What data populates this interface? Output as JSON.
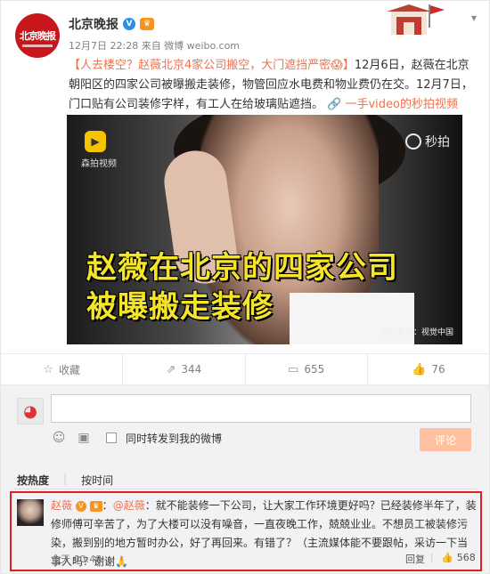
{
  "post": {
    "author": "北京晚报",
    "avatar_text": "北京晚报",
    "badge_v": "V",
    "badge_vip": "♛",
    "meta": "12月7日 22:28 来自 微博 weibo.com",
    "topic": "【人去楼空？赵薇北京4家公司搬空，大门遮挡严密😱】",
    "body": "12月6日，赵薇在北京朝阳区的四家公司被曝搬走装修，物管回应水电费和物业费仍在交。12月7日，门口贴有公司装修字样，有工人在给玻璃贴遮挡。",
    "link": "一手video的秒拍视频",
    "link_icon": "link-icon"
  },
  "video": {
    "caption_line1": "赵薇在北京的四家公司",
    "caption_line2": "被曝搬走装修",
    "source_logo_text": "森拍视频",
    "brand": "秒拍",
    "credit": "图片来源：视觉中国"
  },
  "actions": {
    "favorite_label": "收藏",
    "repost_count": "344",
    "comment_count": "655",
    "like_count": "76"
  },
  "comment_box": {
    "placeholder": "",
    "repost_checkbox_label": "同时转发到我的微博",
    "submit_label": "评论"
  },
  "sort": {
    "by_hot": "按热度",
    "by_time": "按时间"
  },
  "comment": {
    "name": "赵薇",
    "badge_v": "V",
    "badge_vip": "♛",
    "mention": "@赵薇",
    "text": "：就不能装修一下公司，让大家工作环境更好吗？已经装修半年了，装修师傅可辛苦了，为了大楼可以没有噪音，一直夜晚工作，兢兢业业。不想员工被装修污染，搬到别的地方暂时办公，好了再回来。有错了？（主流媒体能不要跟帖，采访一下当事人吗？谢谢🙏",
    "time": "今天 00:48",
    "reply_label": "回复",
    "like_count": "568"
  }
}
